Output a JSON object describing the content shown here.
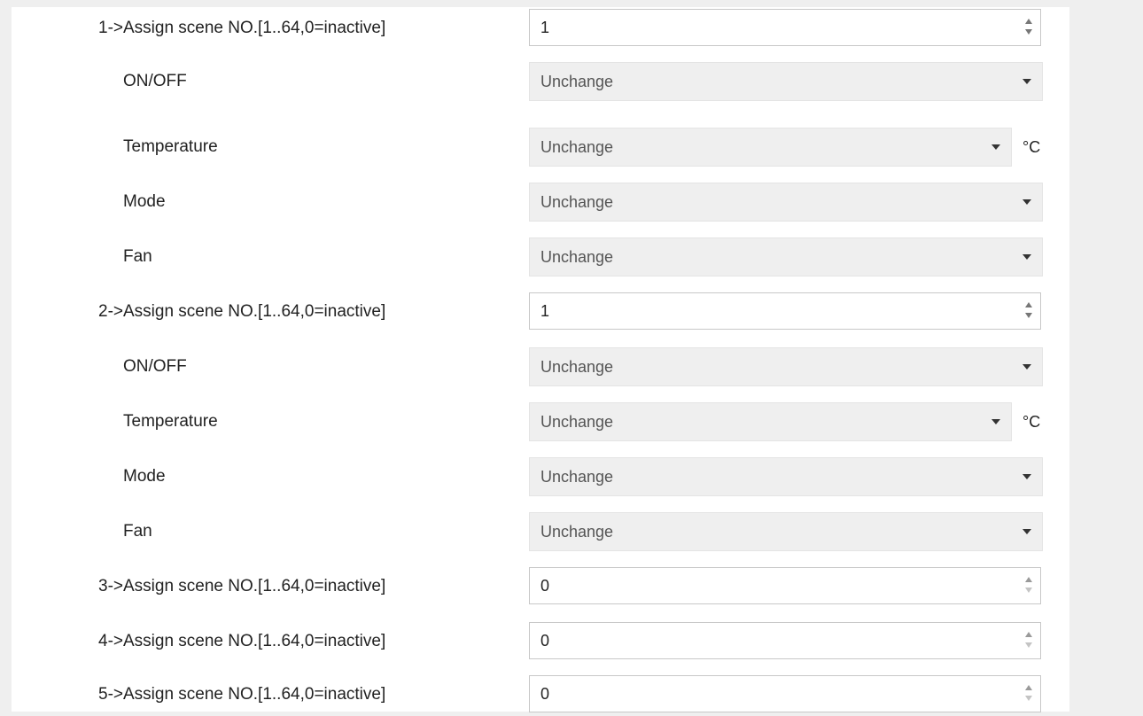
{
  "settings": {
    "groups": [
      {
        "scene_label": "1->Assign scene NO.[1..64,0=inactive]",
        "scene_value": "1",
        "onoff_label": "ON/OFF",
        "onoff_value": "Unchange",
        "temperature_label": "Temperature",
        "temperature_value": "Unchange",
        "temperature_unit": "°C",
        "mode_label": "Mode",
        "mode_value": "Unchange",
        "fan_label": "Fan",
        "fan_value": "Unchange"
      },
      {
        "scene_label": "2->Assign scene NO.[1..64,0=inactive]",
        "scene_value": "1",
        "onoff_label": "ON/OFF",
        "onoff_value": "Unchange",
        "temperature_label": "Temperature",
        "temperature_value": "Unchange",
        "temperature_unit": "°C",
        "mode_label": "Mode",
        "mode_value": "Unchange",
        "fan_label": "Fan",
        "fan_value": "Unchange"
      },
      {
        "scene_label": "3->Assign scene NO.[1..64,0=inactive]",
        "scene_value": "0"
      },
      {
        "scene_label": "4->Assign scene NO.[1..64,0=inactive]",
        "scene_value": "0"
      },
      {
        "scene_label": "5->Assign scene NO.[1..64,0=inactive]",
        "scene_value": "0"
      }
    ]
  },
  "icons": {
    "spinner": "spinner-arrows-icon",
    "dropdown": "chevron-down-icon"
  },
  "colors": {
    "panel_background": "#ffffff",
    "page_background": "#efefef",
    "select_background": "#efefef",
    "input_border": "#c8c8c8"
  }
}
